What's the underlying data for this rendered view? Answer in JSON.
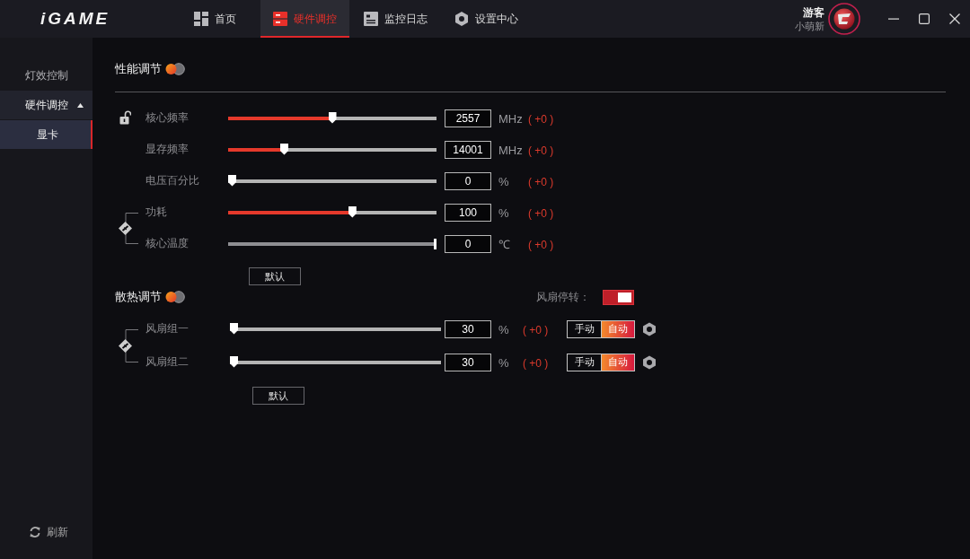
{
  "topbar": {
    "logo": "iGAME",
    "tabs": [
      {
        "label": "首页",
        "selected": false
      },
      {
        "label": "硬件调控",
        "selected": true
      },
      {
        "label": "监控日志",
        "selected": false
      },
      {
        "label": "设置中心",
        "selected": false
      }
    ],
    "user": {
      "name": "游客",
      "rank": "小萌新"
    }
  },
  "sidebar": {
    "items": [
      {
        "label": "灯效控制",
        "selected": false
      },
      {
        "label": "硬件调控",
        "selected": false,
        "expanded": true,
        "children": [
          {
            "label": "显卡",
            "selected": true
          }
        ]
      }
    ],
    "refresh": "刷新"
  },
  "performance": {
    "title": "性能调节",
    "groups": [
      {
        "kind": "lock",
        "rows": [
          {
            "label": "核心频率",
            "level": 0.5,
            "value": "2557",
            "unit": "MHz",
            "delta": "( +0 )",
            "disabled": false
          }
        ]
      },
      {
        "kind": "plain",
        "rows": [
          {
            "label": "显存频率",
            "level": 0.26,
            "value": "14001",
            "unit": "MHz",
            "delta": "( +0 )",
            "disabled": false
          },
          {
            "label": "电压百分比",
            "level": 0,
            "value": "0",
            "unit": "%",
            "delta": "( +0 )",
            "disabled": false
          }
        ]
      },
      {
        "kind": "linked",
        "rows": [
          {
            "label": "功耗",
            "level": 0.6,
            "value": "100",
            "unit": "%",
            "delta": "( +0 )",
            "disabled": false
          },
          {
            "label": "核心温度",
            "level": 1,
            "value": "0",
            "unit": "℃",
            "delta": "( +0 )",
            "disabled": true
          }
        ]
      }
    ],
    "default_button": "默认"
  },
  "cooling": {
    "title": "散热调节",
    "fan_stop": {
      "label": "风扇停转：",
      "on": true
    },
    "groups": [
      {
        "kind": "linked",
        "rows": [
          {
            "label": "风扇组一",
            "level": 0,
            "value": "30",
            "unit": "%",
            "delta": "( +0 )",
            "disabled": false,
            "modes": [
              {
                "label": "手动",
                "selected": false
              },
              {
                "label": "自动",
                "selected": true
              }
            ]
          },
          {
            "label": "风扇组二",
            "level": 0,
            "value": "30",
            "unit": "%",
            "delta": "( +0 )",
            "disabled": false,
            "modes": [
              {
                "label": "手动",
                "selected": false
              },
              {
                "label": "自动",
                "selected": true
              }
            ]
          }
        ]
      }
    ],
    "default_button": "默认"
  }
}
